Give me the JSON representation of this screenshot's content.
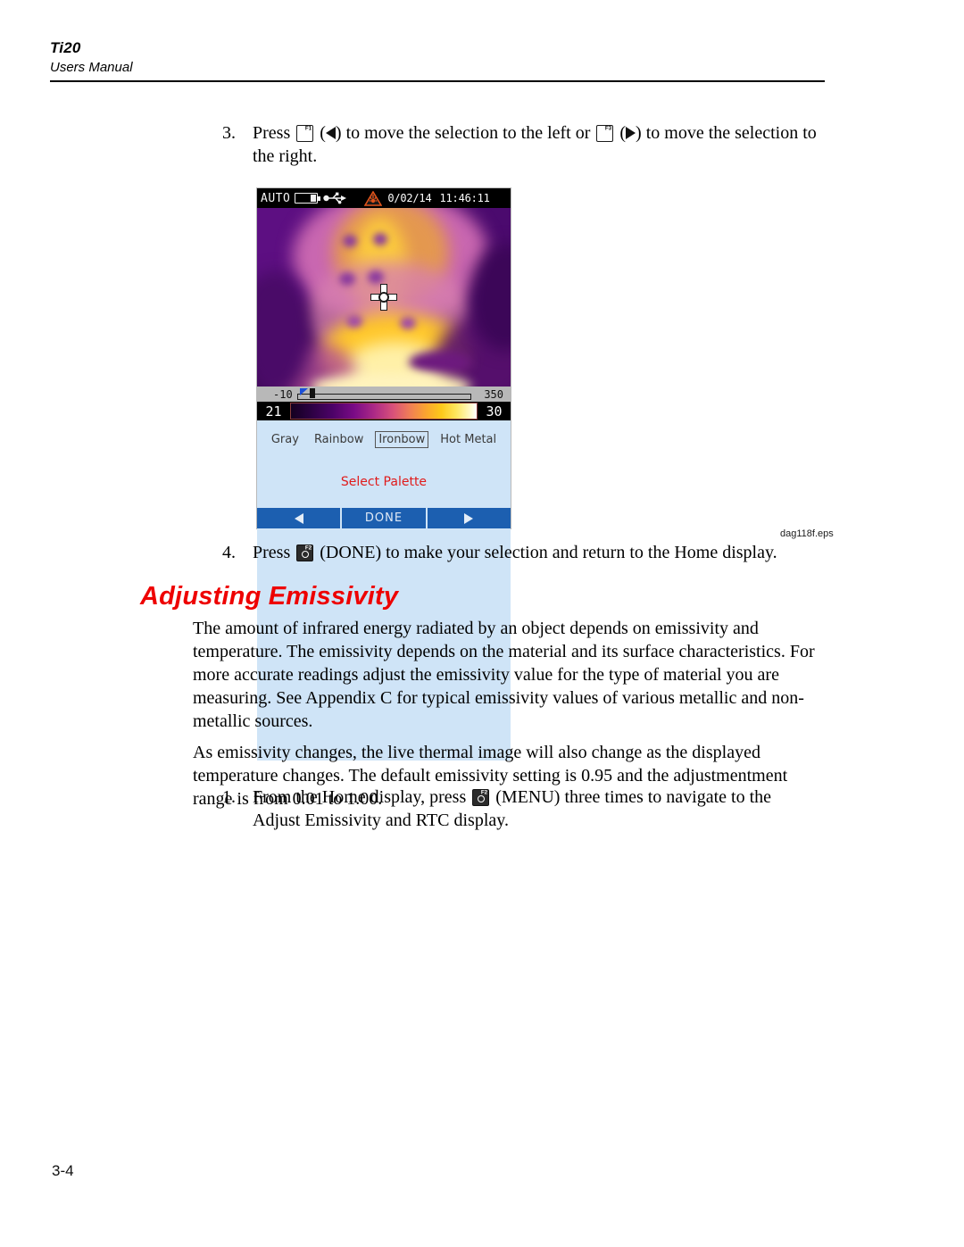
{
  "header": {
    "doc_title": "Ti20",
    "doc_subtitle": "Users Manual"
  },
  "steps": {
    "step3": {
      "number": "3.",
      "text_a": "Press",
      "key1": "F1",
      "text_b": ") to move the selection to the left or",
      "key2": "F3",
      "text_c": ") to move the selection to the right."
    },
    "step4": {
      "number": "4.",
      "text_a": "Press",
      "key1": "F2",
      "text_b": "(DONE) to make your selection and return to the Home display."
    },
    "step1": {
      "number": "1.",
      "text_a": "From the Home display, press",
      "key1": "F2",
      "text_b": "(MENU) three times to navigate to the Adjust Emissivity and RTC display."
    }
  },
  "figure": {
    "caption": "dag118f.eps",
    "status_bar": {
      "mode": "AUTO",
      "battery_icon": "battery-icon",
      "usb_icon": "usb-icon",
      "laser_icon": "laser-warning-icon",
      "date": "0/02/14",
      "time": "11:46:11"
    },
    "range": {
      "min": "-10",
      "max": "350"
    },
    "scale": {
      "low": "21",
      "high": "30"
    },
    "palette_options": [
      {
        "label": "Gray",
        "selected": false
      },
      {
        "label": "Rainbow",
        "selected": false
      },
      {
        "label": "Ironbow",
        "selected": true
      },
      {
        "label": "Hot Metal",
        "selected": false
      }
    ],
    "prompt": "Select Palette",
    "softkeys": {
      "left": "left-arrow-icon",
      "center": "DONE",
      "right": "right-arrow-icon"
    },
    "colors": {
      "panel_background": "#cfe4f7",
      "softkey_blue": "#1c5fb0",
      "prompt_red": "#e01b1b",
      "laser_orange": "#e0531a"
    }
  },
  "section": {
    "heading": "Adjusting Emissivity",
    "heading_color": "#ee0000",
    "paragraph1": "The amount of infrared energy radiated by an object depends on emissivity and temperature. The emissivity depends on the material and its surface characteristics. For more accurate readings adjust the emissivity value for the type of material you are measuring. See Appendix C for typical emissivity values of various metallic and non-metallic sources.",
    "paragraph2": "As emissivity changes, the live thermal image will also change as the displayed temperature changes. The default emissivity setting is 0.95 and the adjustmentment range is from 0.01 to 1.00."
  },
  "footer": {
    "page_number": "3-4"
  }
}
